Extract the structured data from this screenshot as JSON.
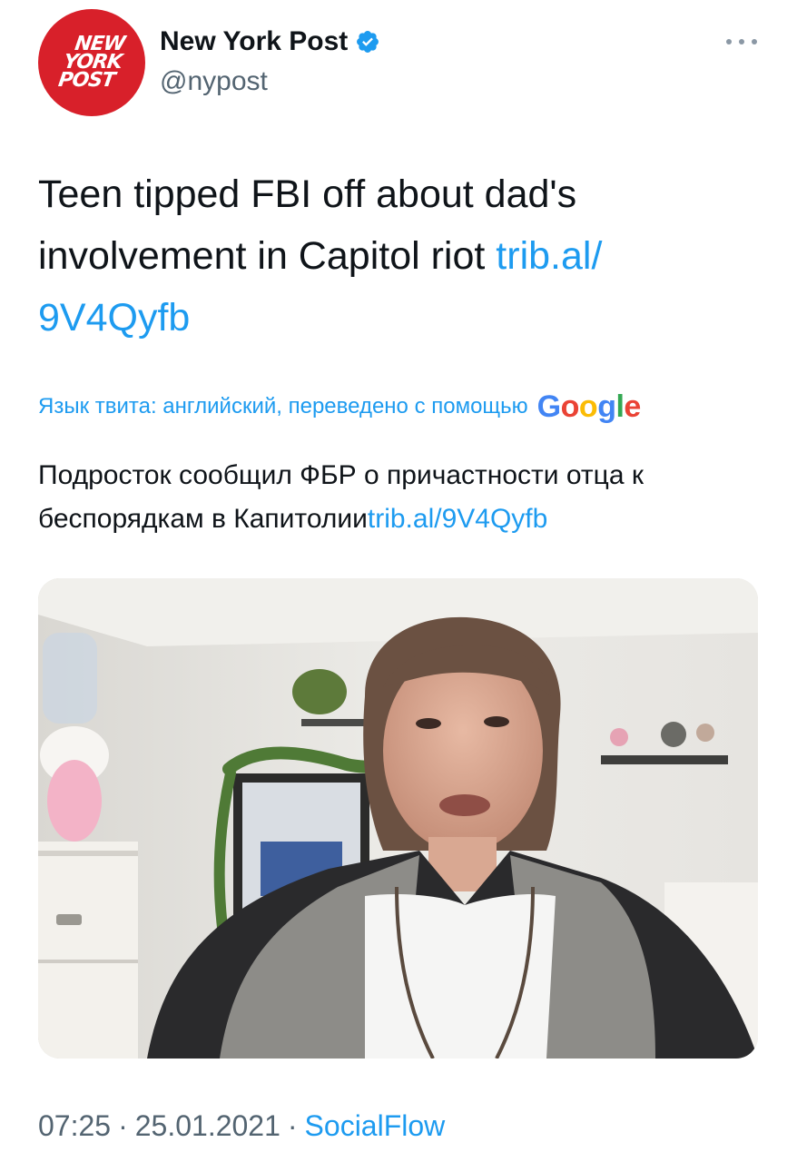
{
  "account": {
    "display_name": "New York Post",
    "handle": "@nypost",
    "avatar_lines": [
      "NEW",
      "YORK",
      "POST"
    ],
    "verified": true
  },
  "tweet": {
    "text": "Teen tipped FBI off about dad's involvement in Capitol riot ",
    "link_text": "trib.al/ 9V4Qyfb"
  },
  "translation": {
    "notice": "Язык твита: английский, переведено с помощью",
    "provider": "Google",
    "text": "Подросток сообщил ФБР о причастности отца к беспорядкам в Капитолии",
    "link_text": "trib.al/9V4Qyfb"
  },
  "footer": {
    "time": "07:25",
    "date": "25.01.2021",
    "separator": "·",
    "source": "SocialFlow"
  },
  "colors": {
    "link": "#1d9bf0",
    "verified": "#1d9bf0",
    "avatar_bg": "#d8202a",
    "google_blue": "#4285F4",
    "google_red": "#EA4335",
    "google_yellow": "#FBBC05",
    "google_green": "#34A853"
  },
  "icons": {
    "verified": "verified-badge-icon",
    "more": "more-options-icon"
  }
}
